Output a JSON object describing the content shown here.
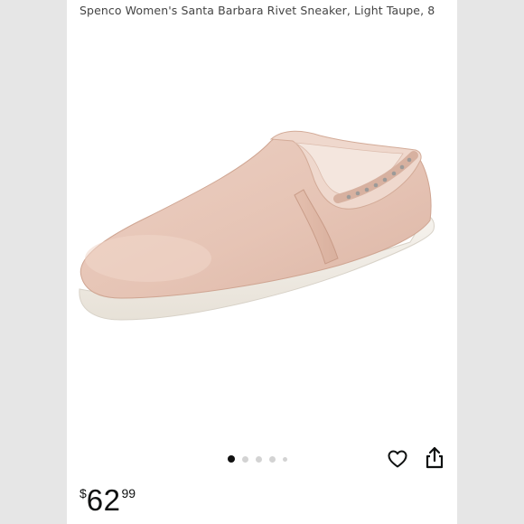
{
  "product": {
    "title": "Spenco Women's Santa Barbara Rivet Sneaker, Light Taupe, 8",
    "image_alt": "light-taupe-slip-on-sneaker"
  },
  "gallery": {
    "dot_count": 5,
    "active_index": 0
  },
  "actions": {
    "favorite_icon": "heart-icon",
    "share_icon": "share-icon"
  },
  "price": {
    "symbol": "$",
    "whole": "62",
    "fraction": "99"
  },
  "colors": {
    "suede": "#e8c9bb",
    "sole": "#f3f0ea",
    "text": "#0f1111"
  }
}
